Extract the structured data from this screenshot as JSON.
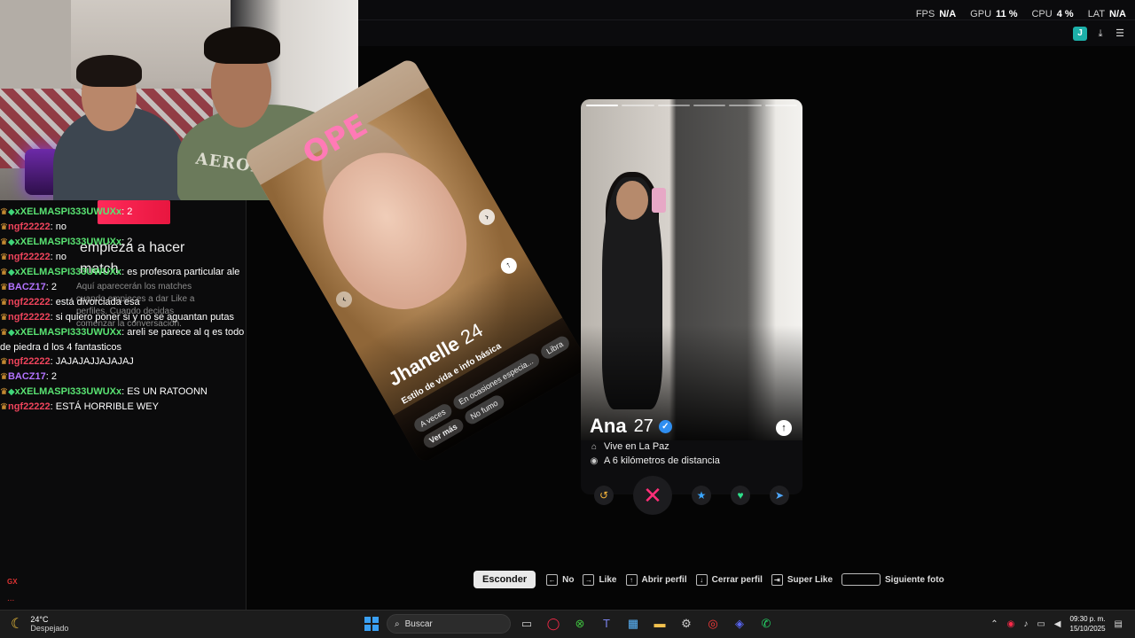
{
  "perf": {
    "fps_label": "FPS",
    "fps_value": "N/A",
    "gpu_label": "GPU",
    "gpu_value": "11 %",
    "cpu_label": "CPU",
    "cpu_value": "4 %",
    "lat_label": "LAT",
    "lat_value": "N/A"
  },
  "top_icons": {
    "avatar_letter": "J",
    "download_icon": "download-icon",
    "menu_icon": "menu-icon"
  },
  "webcam": {
    "shirt_text": "AEROPOSTALE"
  },
  "chat": [
    {
      "user": "xXELMASPI333UWUXx",
      "color": "green",
      "gem": true,
      "text": ": 2"
    },
    {
      "user": "ngf22222",
      "color": "red",
      "gem": false,
      "text": ": no"
    },
    {
      "user": "xXELMASPI333UWUXx",
      "color": "green",
      "gem": true,
      "text": ": 2"
    },
    {
      "user": "ngf22222",
      "color": "red",
      "gem": false,
      "text": ": no"
    },
    {
      "user": "xXELMASPI333UWUXx",
      "color": "green",
      "gem": true,
      "text": ": es profesora particular ale"
    },
    {
      "user": "BACZ17",
      "color": "purple",
      "gem": false,
      "text": ": 2"
    },
    {
      "user": "ngf22222",
      "color": "red",
      "gem": false,
      "text": ": está divorciada esa"
    },
    {
      "user": "ngf22222",
      "color": "red",
      "gem": false,
      "text": ": si quiero poner si y no se aguantan putas"
    },
    {
      "user": "xXELMASPI333UWUXx",
      "color": "green",
      "gem": true,
      "text": ": areli se parece al q es todo de piedra d los 4 fantasticos"
    },
    {
      "user": "ngf22222",
      "color": "red",
      "gem": false,
      "text": ": JAJAJAJJAJAJAJ"
    },
    {
      "user": "BACZ17",
      "color": "purple",
      "gem": false,
      "text": ": 2"
    },
    {
      "user": "xXELMASPI333UWUXx",
      "color": "green",
      "gem": true,
      "text": ": ES UN RATOONN"
    },
    {
      "user": "ngf22222",
      "color": "red",
      "gem": false,
      "text": ": ESTÁ HORRIBLE WEY"
    }
  ],
  "match_panel": {
    "title": "empieza a hacer match",
    "description": "Aquí aparecerán los matches cuando empieces a dar Like a perfiles. Cuando decidas comenzar la conversación."
  },
  "rotated_card": {
    "overlay_text": "OPE",
    "name": "Jhanelle",
    "age": "24",
    "subtitle": "Estilo de vida e info básica",
    "chips": [
      "A veces",
      "En ocasiones especia...",
      "Libra",
      "No fumo"
    ],
    "more": "Ver más"
  },
  "profile": {
    "name": "Ana",
    "age": "27",
    "verified": true,
    "lives": "Vive en La Paz",
    "distance": "A 6 kilómetros de distancia",
    "photo_count": 6,
    "current_photo": 1
  },
  "actions": [
    "rewind-icon",
    "nope-icon",
    "super-like-icon",
    "like-icon",
    "boost-icon"
  ],
  "shortcuts": {
    "hide": "Esconder",
    "items": [
      {
        "key": "←",
        "label": "No"
      },
      {
        "key": "→",
        "label": "Like"
      },
      {
        "key": "↑",
        "label": "Abrir perfil"
      },
      {
        "key": "↓",
        "label": "Cerrar perfil"
      },
      {
        "key": "⇥",
        "label": "Super Like"
      },
      {
        "key": "",
        "label": "Siguiente foto"
      }
    ]
  },
  "gx_side": {
    "label": "GX",
    "dots": "..."
  },
  "taskbar": {
    "temp": "24°C",
    "weather": "Despejado",
    "search_placeholder": "Buscar",
    "time": "09:30 p. m.",
    "date": "15/10/2025"
  }
}
